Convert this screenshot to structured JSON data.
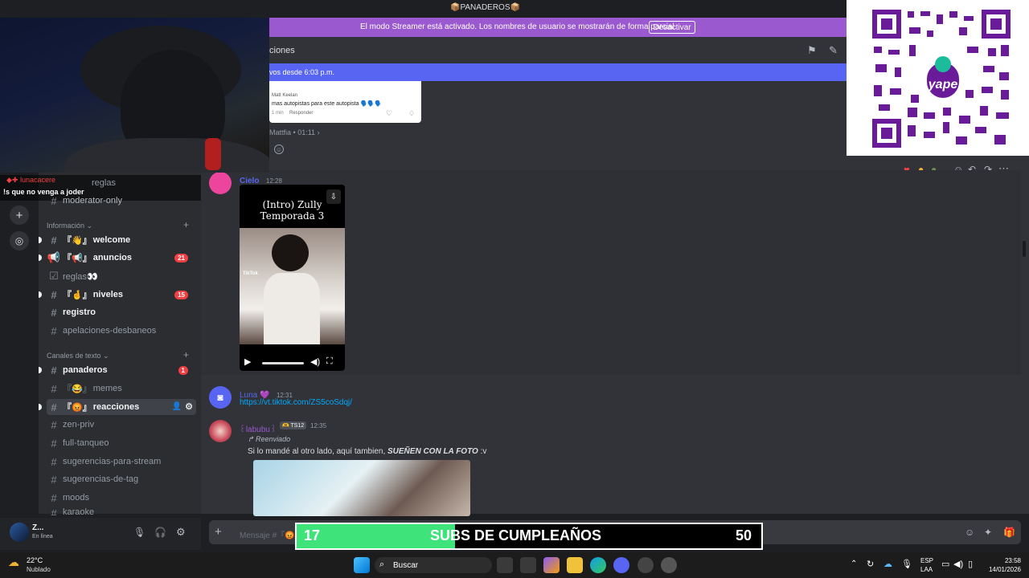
{
  "window": {
    "title": "📦PANADEROS📦"
  },
  "streamer_banner": {
    "text": "El modo Streamer está activado. Los nombres de usuario se mostrarán de forma parcial.",
    "button": "Desactivar"
  },
  "header": {
    "channel_title": "ciones",
    "new_messages": "vos desde 6:03 p.m."
  },
  "overlay_chat": {
    "username": "lunacacere",
    "message": "!s que no venga a joder"
  },
  "sidebar": {
    "top_items": [
      {
        "label": "reglas"
      },
      {
        "label": "moderator-only"
      }
    ],
    "categories": [
      {
        "label": "Información"
      },
      {
        "label": "Canales de texto"
      }
    ],
    "channels": [
      {
        "label": "welcome",
        "prefix": "『👋』",
        "badge": ""
      },
      {
        "label": "anuncios",
        "prefix": "『📢』",
        "badge": "21"
      },
      {
        "label": "reglas👀",
        "prefix": "",
        "badge": ""
      },
      {
        "label": "niveles",
        "prefix": "『🤞』",
        "badge": "15"
      },
      {
        "label": "registro",
        "prefix": "",
        "badge": ""
      },
      {
        "label": "apelaciones-desbaneos",
        "prefix": "",
        "badge": ""
      },
      {
        "label": "panaderos",
        "prefix": "",
        "badge": "1"
      },
      {
        "label": "memes",
        "prefix": "『😂』",
        "badge": ""
      },
      {
        "label": "reacciones",
        "prefix": "『😡』",
        "badge": ""
      },
      {
        "label": "zen-priv",
        "prefix": "",
        "badge": ""
      },
      {
        "label": "full-tanqueo",
        "prefix": "",
        "badge": ""
      },
      {
        "label": "sugerencias-para-stream",
        "prefix": "",
        "badge": ""
      },
      {
        "label": "sugerencias-de-tag",
        "prefix": "",
        "badge": ""
      },
      {
        "label": "moods",
        "prefix": "",
        "badge": ""
      },
      {
        "label": "karaoke",
        "prefix": "",
        "badge": ""
      }
    ]
  },
  "messages": {
    "quoted_card": {
      "author": "Matt Keelan",
      "text": "mas autopistas para este autopista 🗣️🗣️🗣️",
      "time": "1 min",
      "reply": "Responder"
    },
    "mattfia": {
      "author": "Mattfia",
      "time": "01:11"
    },
    "cielo": {
      "author": "Cielo",
      "time": "12:28",
      "video_title": "(Intro) Zully Temporada 3",
      "tiktok": "TikTok"
    },
    "luna": {
      "author": "Luna 💜",
      "time": "12:31",
      "link": "https://vt.tiktok.com/ZS5coSdqj/"
    },
    "labubu": {
      "author": "꒰labubu꒱",
      "tag": "🫶 TS12",
      "time": "12:35",
      "forwarded": "Reenviado",
      "text_plain": "Si lo mandé al otro lado, aquí tambien, ",
      "text_bold": "SUEÑEN CON LA FOTO",
      "text_end": " :v"
    }
  },
  "composer": {
    "placeholder": "Mensaje #『😡』"
  },
  "user": {
    "name": "Z...",
    "status": "En línea"
  },
  "subs_goal": {
    "current": "17",
    "label": "SUBS DE CUMPLEAÑOS",
    "target": "50",
    "progress": 0.34
  },
  "taskbar": {
    "weather_temp": "22°C",
    "weather_text": "Nublado",
    "search": "Buscar",
    "lang1": "ESP",
    "lang2": "LAA",
    "time": "23:58",
    "date": "14/01/2026"
  },
  "colors": {
    "accent": "#5865f2",
    "streamer": "#9b59d0",
    "badge": "#f23f43",
    "goal_fill": "#3ee37a"
  }
}
